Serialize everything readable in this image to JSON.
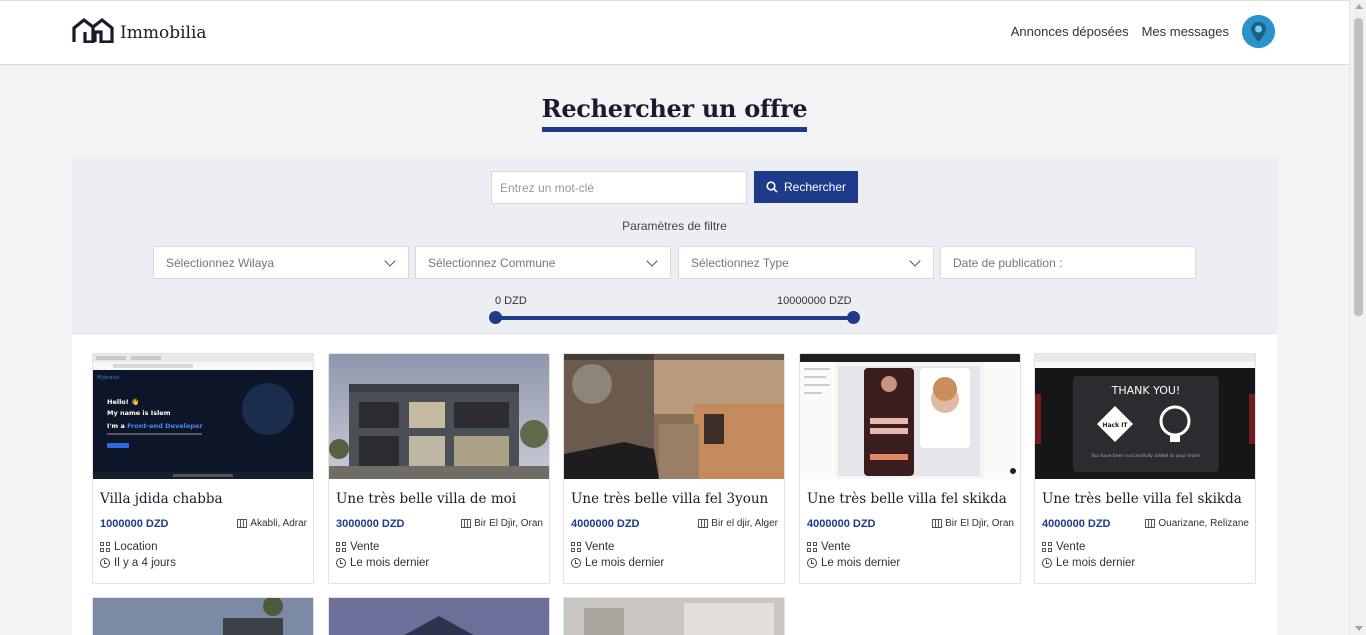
{
  "brand": {
    "name": "Immobilia"
  },
  "nav": {
    "link1": "Annonces déposées",
    "link2": "Mes messages"
  },
  "page": {
    "title": "Rechercher un offre"
  },
  "search": {
    "placeholder": "Entrez un mot-clé",
    "button": "Rechercher",
    "filter_label": "Paramètres de filtre",
    "wilaya": "Sélectionnez Wilaya",
    "commune": "Sélectionnez Commune",
    "type": "Sélectionnez Type",
    "date": "Date de publication :",
    "price_min": "0 DZD",
    "price_max": "10000000 DZD"
  },
  "listings": [
    {
      "title": "Villa jdida chabba",
      "price": "1000000 DZD",
      "location": "Akabli, Adrar",
      "type": "Location",
      "date": "Il y a 4 jours"
    },
    {
      "title": "Une très belle villa de moi",
      "price": "3000000 DZD",
      "location": "Bir El Djir, Oran",
      "type": "Vente",
      "date": "Le mois dernier"
    },
    {
      "title": "Une très belle villa fel 3youn",
      "price": "4000000 DZD",
      "location": "Bir el djir, Alger",
      "type": "Vente",
      "date": "Le mois dernier"
    },
    {
      "title": "Une très belle villa fel skikda",
      "price": "4000000 DZD",
      "location": "Bir El Djir, Oran",
      "type": "Vente",
      "date": "Le mois dernier"
    },
    {
      "title": "Une très belle villa fel skikda",
      "price": "4000000 DZD",
      "location": "Ouarizane, Relizane",
      "type": "Vente",
      "date": "Le mois dernier"
    }
  ],
  "card1_image": {
    "line1": "Hello! 👋",
    "line2": "My name is Islem",
    "line3a": "I'm a ",
    "line3b": "Front-end Developer"
  },
  "card5_image": {
    "heading": "THANK YOU!",
    "logo1": "Hack IT",
    "footer": "You have been successfully added to your team!"
  },
  "colors": {
    "primary": "#1f3a8a",
    "avatar": "#2a93c9"
  }
}
